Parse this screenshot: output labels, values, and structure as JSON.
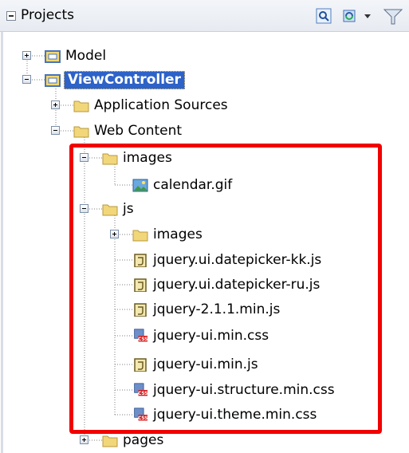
{
  "panel": {
    "title": "Projects",
    "toolbar_icons": [
      "search-icon",
      "sync-icon",
      "dropdown-arrow-icon",
      "filter-icon"
    ]
  },
  "tree": [
    {
      "label": "Model",
      "icon": "project-icon",
      "expanded": false
    },
    {
      "label": "ViewController",
      "icon": "project-icon",
      "expanded": true,
      "selected": true
    },
    {
      "label": "Application Sources",
      "icon": "folder-icon",
      "expanded": false
    },
    {
      "label": "Web Content",
      "icon": "folder-icon",
      "expanded": true
    },
    {
      "label": "images",
      "icon": "folder-icon",
      "expanded": true
    },
    {
      "label": "calendar.gif",
      "icon": "image-file-icon"
    },
    {
      "label": "js",
      "icon": "folder-icon",
      "expanded": true
    },
    {
      "label": "images",
      "icon": "folder-icon",
      "expanded": false
    },
    {
      "label": "jquery.ui.datepicker-kk.js",
      "icon": "js-file-icon"
    },
    {
      "label": "jquery.ui.datepicker-ru.js",
      "icon": "js-file-icon"
    },
    {
      "label": "jquery-2.1.1.min.js",
      "icon": "js-file-icon"
    },
    {
      "label": "jquery-ui.min.css",
      "icon": "css-file-icon",
      "badge": "CSS"
    },
    {
      "label": "jquery-ui.min.js",
      "icon": "js-file-icon"
    },
    {
      "label": "jquery-ui.structure.min.css",
      "icon": "css-file-icon",
      "badge": "CSS"
    },
    {
      "label": "jquery-ui.theme.min.css",
      "icon": "css-file-icon",
      "badge": "CSS"
    },
    {
      "label": "pages",
      "icon": "folder-icon",
      "expanded": false
    }
  ],
  "colors": {
    "highlight": "#f20000",
    "selection": "#2d62c8",
    "folder": "#f1d67a"
  }
}
